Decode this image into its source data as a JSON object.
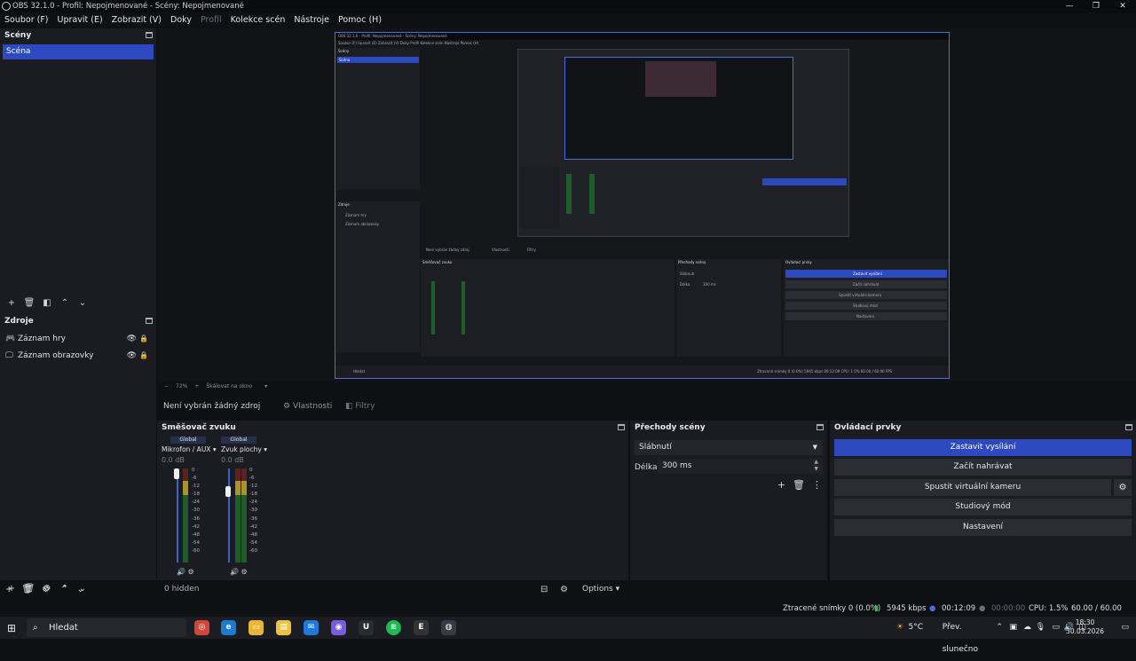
{
  "window": {
    "title": "OBS 32.1.0 - Profil: Nepojmenované - Scény: Nepojmenované",
    "min": "—",
    "max": "❐",
    "close": "✕"
  },
  "menu": [
    "Soubor (F)",
    "Upravit (E)",
    "Zobrazit (V)",
    "Doky",
    "Profil",
    "Kolekce scén",
    "Nástroje",
    "Pomoc (H)"
  ],
  "scenes": {
    "title": "Scény",
    "items": [
      "Scéna"
    ]
  },
  "sources": {
    "title": "Zdroje",
    "items": [
      {
        "name": "Záznam hry",
        "icon": "gamepad-icon"
      },
      {
        "name": "Záznam obrazovky",
        "icon": "monitor-icon"
      }
    ]
  },
  "zoom": {
    "minus": "−",
    "value": "72%",
    "plus": "+",
    "mode": "Škálovat na okno"
  },
  "source_bar": {
    "none": "Není vybrán žádný zdroj",
    "properties": "Vlastnosti",
    "filters": "Filtry"
  },
  "mixer": {
    "title": "Směšovač zvuku",
    "channels": [
      {
        "group": "Global",
        "name": "Mikrofon / AUX",
        "db": "0.0 dB"
      },
      {
        "group": "Global",
        "name": "Zvuk plochy",
        "db": "0.0 dB"
      }
    ],
    "scale": [
      "0",
      "-6",
      "-12",
      "-18",
      "-24",
      "-30",
      "-36",
      "-42",
      "-48",
      "-54",
      "-60"
    ],
    "hidden": "0 hidden",
    "options": "Options"
  },
  "transitions": {
    "title": "Přechody scény",
    "selected": "Slábnutí",
    "delay_label": "Délka",
    "delay_value": "300 ms"
  },
  "controls": {
    "title": "Ovládací prvky",
    "buttons": [
      "Zastavit vysílání",
      "Začít nahrávat",
      "Spustit virtuální kameru",
      "Studiový mód",
      "Nastavení"
    ]
  },
  "status": {
    "dropped": "Ztracené snímky 0 (0.0%)",
    "bitrate": "5945 kbps",
    "stream_time": "00:12:09",
    "rec_time": "00:00:00",
    "cpu": "CPU: 1.5%",
    "fps": "60.00 / 60.00 FPS"
  },
  "taskbar": {
    "search": "Hledat",
    "weather": "5°C",
    "weather_text": "Přev. slunečno",
    "time": "18:30",
    "date": "30.03.2026"
  },
  "nested": {
    "menu": "Soubor (F)   Upravit (E)   Zobrazit (V)   Doky   Profil   Kolekce scén   Nástroje   Pomoc (H)",
    "title": "OBS 32.1.0 - Profil: Nepojmenované - Scény: Nepojmenované",
    "scenes": "Scény",
    "scene": "Scéna",
    "sources": "Zdroje",
    "src1": "Záznam hry",
    "src2": "Záznam obrazovky",
    "nosrc": "Není vybrán žádný zdroj",
    "props": "Vlastnosti",
    "filters": "Filtry",
    "mixer": "Směšovač zvuku",
    "trans": "Přechody scény",
    "ctrl": "Ovládací prvky",
    "fade": "Slábnutí",
    "delay": "Délka",
    "delayv": "300 ms",
    "b1": "Zastavit vysílání",
    "b2": "Začít nahrávat",
    "b3": "Spustit virtuální kameru",
    "b4": "Studiový mód",
    "b5": "Nastavení",
    "search": "Hledat",
    "status": "Ztracené snímky 0 (0.0%)   5945 kbps   00:12:09   CPU: 1.5%   60.00 / 60.00 FPS"
  }
}
